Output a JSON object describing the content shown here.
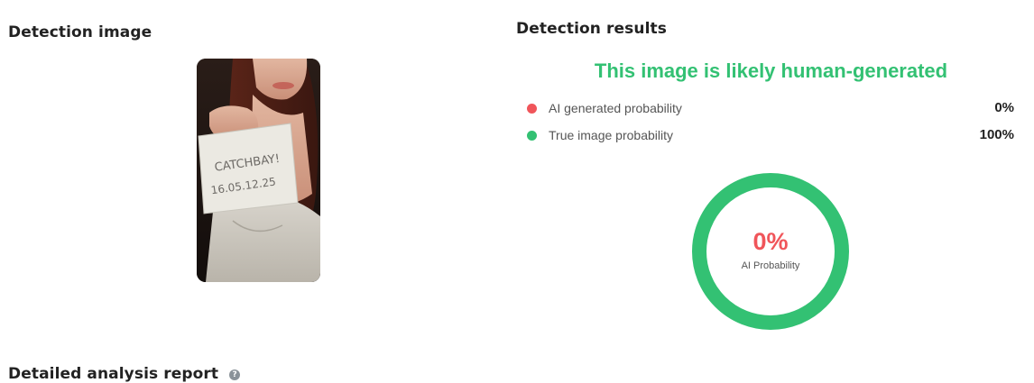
{
  "detection_image": {
    "title": "Detection image",
    "note_text_line1": "CATCHBAY!",
    "note_text_line2": "16.05.12.25"
  },
  "detection_results": {
    "title": "Detection results",
    "verdict": "This image is likely human-generated",
    "verdict_color": "#33c173",
    "rows": [
      {
        "label": "AI generated probability",
        "value": "0%",
        "dot_color": "#f0555a"
      },
      {
        "label": "True image probability",
        "value": "100%",
        "dot_color": "#33c173"
      }
    ],
    "gauge": {
      "value_text": "0%",
      "value_color": "#f0555a",
      "label": "AI Probability",
      "ai_fraction": 0.0,
      "ring_color": "#33c173"
    }
  },
  "report": {
    "title": "Detailed analysis report",
    "help_icon": "question-circle-icon"
  }
}
